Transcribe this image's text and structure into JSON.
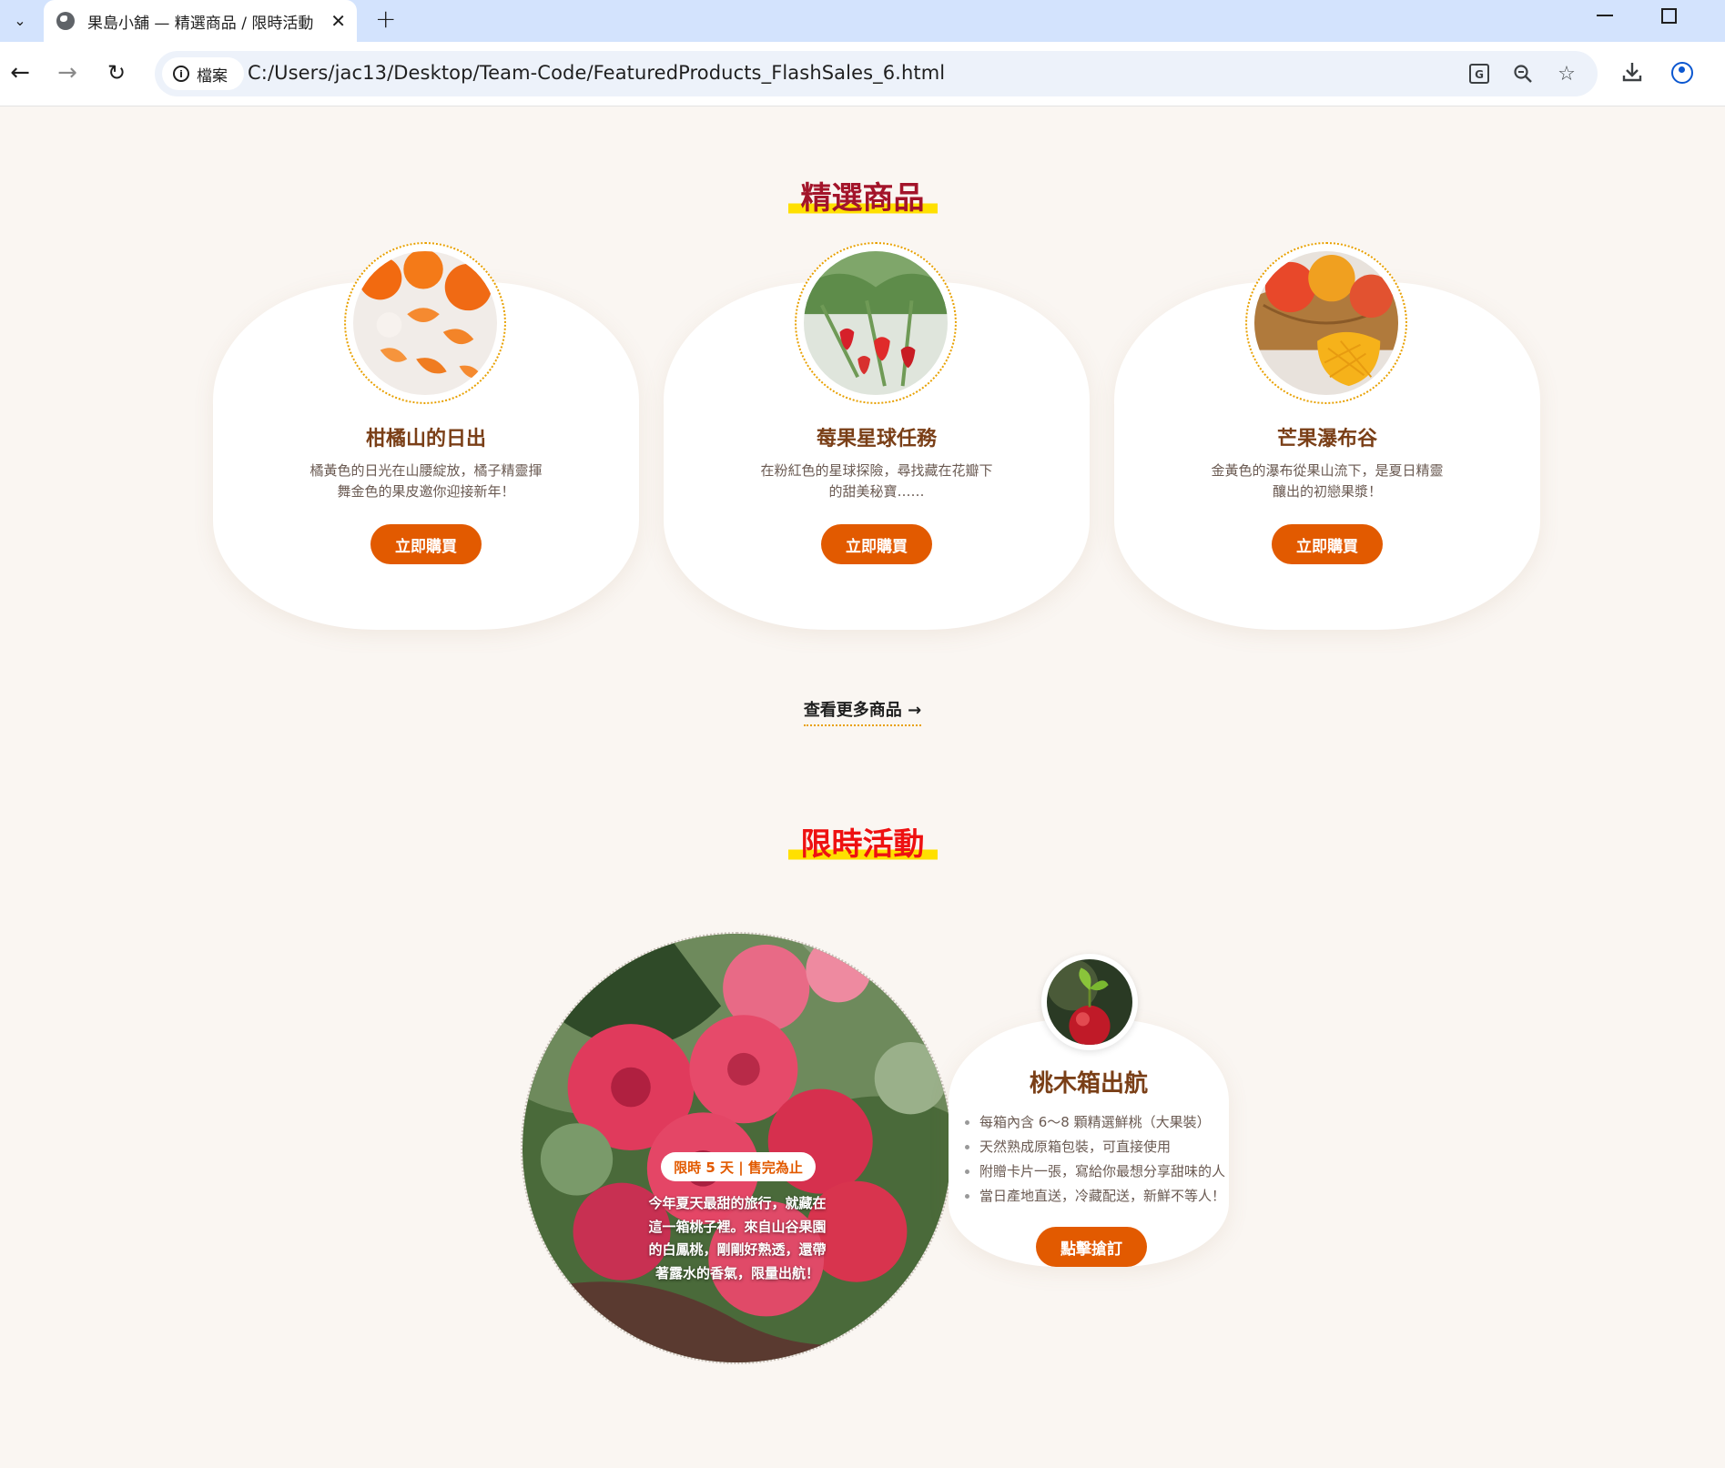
{
  "browser": {
    "tab_title": "果島小舖 — 精選商品 / 限時活動",
    "site_chip_label": "檔案",
    "url": "C:/Users/jac13/Desktop/Team-Code/FeaturedProducts_FlashSales_6.html"
  },
  "featured": {
    "title": "精選商品",
    "products": [
      {
        "name": "柑橘山的日出",
        "desc": "橘黃色的日光在山腰綻放，橘子精靈揮舞金色的果皮邀你迎接新年！",
        "button": "立即購買",
        "image_icon": "tangerine-photo"
      },
      {
        "name": "莓果星球任務",
        "desc": "在粉紅色的星球探險，尋找藏在花瓣下的甜美秘寶……",
        "button": "立即購買",
        "image_icon": "strawberry-photo"
      },
      {
        "name": "芒果瀑布谷",
        "desc": "金黃色的瀑布從果山流下，是夏日精靈釀出的初戀果漿！",
        "button": "立即購買",
        "image_icon": "mango-photo"
      }
    ],
    "more_link": "查看更多商品 →"
  },
  "flash": {
    "title": "限時活動",
    "badge": "限時 5 天 | 售完為止",
    "story": "今年夏天最甜的旅行，就藏在這一箱桃子裡。來自山谷果園的白鳳桃，剛剛好熟透，還帶著露水的香氣，限量出航！",
    "product_name": "桃木箱出航",
    "features": [
      "每箱內含 6～8 顆精選鮮桃（大果裝）",
      "天然熟成原箱包裝，可直接使用",
      "附贈卡片一張，寫給你最想分享甜味的人",
      "當日產地直送，冷藏配送，新鮮不等人！"
    ],
    "button": "點擊搶訂"
  },
  "colors": {
    "accent": "#e25a00",
    "featured_title": "#a3142a",
    "flash_title": "#ee1111",
    "title_highlight": "#ffe000",
    "product_name": "#7a3f17",
    "page_bg": "#faf6f2"
  }
}
